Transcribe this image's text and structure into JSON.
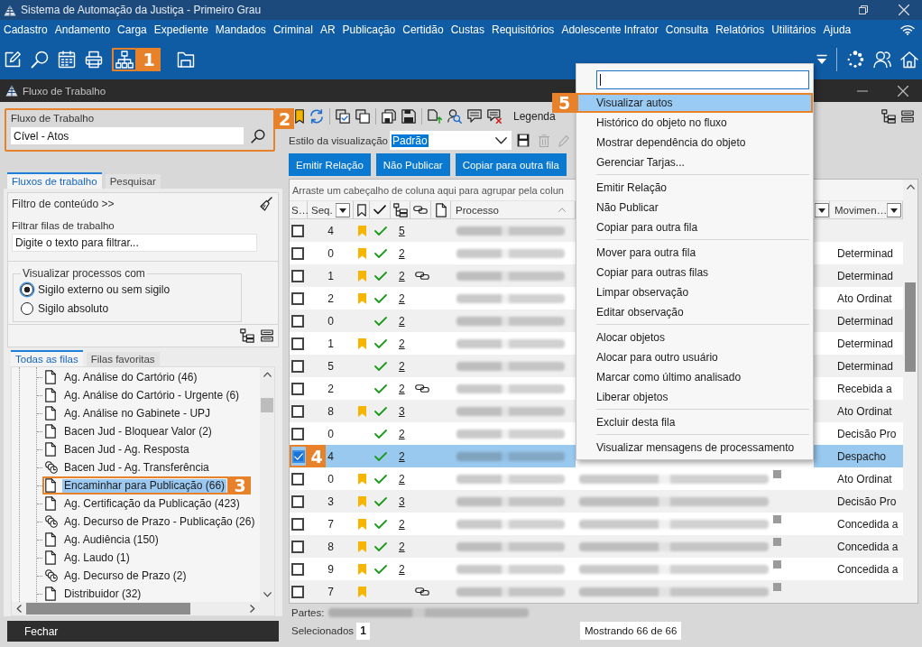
{
  "window": {
    "title": "Sistema de Automação da Justiça - Primeiro Grau"
  },
  "menu_bar": [
    "Cadastro",
    "Andamento",
    "Carga",
    "Expediente",
    "Mandados",
    "Criminal",
    "AR",
    "Publicação",
    "Certidão",
    "Custas",
    "Requisitórios",
    "Adolescente Infrator",
    "Consulta",
    "Relatórios",
    "Utilitários",
    "Ajuda"
  ],
  "toolbar": {
    "callout": "1"
  },
  "child_window": {
    "title": "Fluxo de Trabalho"
  },
  "workflow": {
    "label": "Fluxo de Trabalho",
    "value": "Cível - Atos",
    "callout": "2"
  },
  "side_tabs": [
    {
      "label": "Fluxos de trabalho",
      "selected": true
    },
    {
      "label": "Pesquisar",
      "selected": false
    }
  ],
  "content_filter": {
    "title": "Filtro de conteúdo >>",
    "label": "Filtrar filas de trabalho",
    "placeholder": "Digite o texto para filtrar..."
  },
  "visibility": {
    "legend": "Visualizar processos com",
    "options": [
      {
        "label": "Sigilo externo ou sem sigilo",
        "selected": true
      },
      {
        "label": "Sigilo absoluto",
        "selected": false
      }
    ]
  },
  "queue_tabs": [
    {
      "label": "Todas as filas",
      "selected": true
    },
    {
      "label": "Filas favoritas",
      "selected": false
    }
  ],
  "queues": [
    {
      "name": "Ag. Análise do Cartório (46)",
      "kind": "queue",
      "selected": false
    },
    {
      "name": "Ag. Análise do Cartório - Urgente (6)",
      "kind": "queue",
      "selected": false
    },
    {
      "name": "Ag. Análise no Gabinete - UPJ",
      "kind": "queue",
      "selected": false
    },
    {
      "name": "Bacen Jud - Bloquear Valor (2)",
      "kind": "queue",
      "selected": false
    },
    {
      "name": "Bacen Jud - Ag. Resposta",
      "kind": "queue",
      "selected": false
    },
    {
      "name": "Bacen Jud - Ag. Transferência",
      "kind": "timed",
      "selected": false
    },
    {
      "name": "Encaminhar para Publicação (66)",
      "kind": "queue",
      "selected": true,
      "callout": "3"
    },
    {
      "name": "Ag. Certificação da Publicação (423)",
      "kind": "queue",
      "selected": false
    },
    {
      "name": "Ag. Decurso de Prazo - Publicação (26)",
      "kind": "timed",
      "selected": false
    },
    {
      "name": "Ag. Audiência (150)",
      "kind": "queue",
      "selected": false
    },
    {
      "name": "Ag. Laudo (1)",
      "kind": "queue",
      "selected": false
    },
    {
      "name": "Ag. Decurso de Prazo (2)",
      "kind": "timed",
      "selected": false
    },
    {
      "name": "Distribuidor (32)",
      "kind": "queue",
      "selected": false
    }
  ],
  "close_button": "Fechar",
  "grid_toolbar": {
    "legend": "Legenda"
  },
  "view_style": {
    "label": "Estilo da visualização",
    "value": "Padrão"
  },
  "actions": [
    "Emitir Relação",
    "Não Publicar",
    "Copiar para outra fila"
  ],
  "grid": {
    "group_hint": "Arraste um cabeçalho de coluna aqui para agrupar pela colun",
    "columns": {
      "select": "S…",
      "seq": "Seq.",
      "process": "Processo",
      "movement": "Movimen…"
    },
    "rows": [
      {
        "seq": "4",
        "checked": false,
        "selected": false,
        "bookmarked": true,
        "verified": true,
        "links": "5",
        "chained": false
      },
      {
        "seq": "0",
        "checked": false,
        "selected": false,
        "bookmarked": true,
        "verified": true,
        "links": "2",
        "chained": false,
        "movement": "Determinad"
      },
      {
        "seq": "1",
        "checked": false,
        "selected": false,
        "bookmarked": true,
        "verified": true,
        "links": "2",
        "chained": true,
        "movement": "Determinad"
      },
      {
        "seq": "2",
        "checked": false,
        "selected": false,
        "bookmarked": true,
        "verified": true,
        "links": "2",
        "chained": false,
        "movement": "Ato Ordinat"
      },
      {
        "seq": "0",
        "checked": false,
        "selected": false,
        "bookmarked": false,
        "verified": true,
        "links": "2",
        "chained": false,
        "movement": "Determinad"
      },
      {
        "seq": "1",
        "checked": false,
        "selected": false,
        "bookmarked": true,
        "verified": true,
        "links": "2",
        "chained": false,
        "movement": "Determinad"
      },
      {
        "seq": "5",
        "checked": false,
        "selected": false,
        "bookmarked": false,
        "verified": true,
        "links": "2",
        "chained": false,
        "movement": "Determinad"
      },
      {
        "seq": "2",
        "checked": false,
        "selected": false,
        "bookmarked": false,
        "verified": true,
        "links": "2",
        "chained": true,
        "movement": "Recebida a"
      },
      {
        "seq": "8",
        "checked": false,
        "selected": false,
        "bookmarked": true,
        "verified": true,
        "links": "3",
        "chained": false,
        "movement": "Ato Ordinat"
      },
      {
        "seq": "0",
        "checked": false,
        "selected": false,
        "bookmarked": false,
        "verified": true,
        "links": "2",
        "chained": false,
        "movement": "Decisão Pro"
      },
      {
        "seq": "4",
        "checked": true,
        "selected": true,
        "bookmarked": false,
        "verified": true,
        "links": "2",
        "chained": false,
        "movement": "Despacho",
        "callout": "4"
      },
      {
        "seq": "0",
        "checked": false,
        "selected": false,
        "bookmarked": true,
        "verified": true,
        "links": "2",
        "chained": false,
        "marker": true,
        "movement": "Ato Ordinat"
      },
      {
        "seq": "3",
        "checked": false,
        "selected": false,
        "bookmarked": true,
        "verified": true,
        "links": "3",
        "chained": false,
        "marker": false,
        "movement": "Decisão Pro"
      },
      {
        "seq": "7",
        "checked": false,
        "selected": false,
        "bookmarked": true,
        "verified": true,
        "links": "2",
        "chained": false,
        "marker": true,
        "movement": "Concedida a"
      },
      {
        "seq": "8",
        "checked": false,
        "selected": false,
        "bookmarked": true,
        "verified": true,
        "links": "2",
        "chained": false,
        "marker": true,
        "movement": "Concedida a"
      },
      {
        "seq": "9",
        "checked": false,
        "selected": false,
        "bookmarked": true,
        "verified": true,
        "links": "2",
        "chained": false,
        "marker": true,
        "movement": "Concedida a"
      },
      {
        "seq": "7",
        "checked": false,
        "selected": false,
        "bookmarked": true,
        "verified": false,
        "chained": true,
        "marker": true
      }
    ]
  },
  "footer": {
    "parties_label": "Partes:",
    "selected_label": "Selecionados",
    "selected_count": "1",
    "showing": "Mostrando 66 de 66"
  },
  "context_menu": {
    "groups": [
      [
        {
          "label": "Visualizar autos",
          "selected": true,
          "callout": "5"
        },
        {
          "label": "Histórico do objeto no fluxo",
          "selected": false
        },
        {
          "label": "Mostrar dependência do objeto",
          "selected": false
        },
        {
          "label": "Gerenciar Tarjas...",
          "selected": false
        }
      ],
      [
        {
          "label": "Emitir Relação",
          "selected": false
        },
        {
          "label": "Não Publicar",
          "selected": false
        },
        {
          "label": "Copiar para outra fila",
          "selected": false
        }
      ],
      [
        {
          "label": "Mover para outra fila",
          "selected": false
        },
        {
          "label": "Copiar para outras filas",
          "selected": false
        },
        {
          "label": "Limpar observação",
          "selected": false
        },
        {
          "label": "Editar observação",
          "selected": false
        }
      ],
      [
        {
          "label": "Alocar objetos",
          "selected": false
        },
        {
          "label": "Alocar para outro usuário",
          "selected": false
        },
        {
          "label": "Marcar como último analisado",
          "selected": false
        },
        {
          "label": "Liberar objetos",
          "selected": false
        }
      ],
      [
        {
          "label": "Excluir desta fila",
          "selected": false
        }
      ],
      [
        {
          "label": "Visualizar mensagens de processamento",
          "selected": false
        }
      ]
    ]
  }
}
